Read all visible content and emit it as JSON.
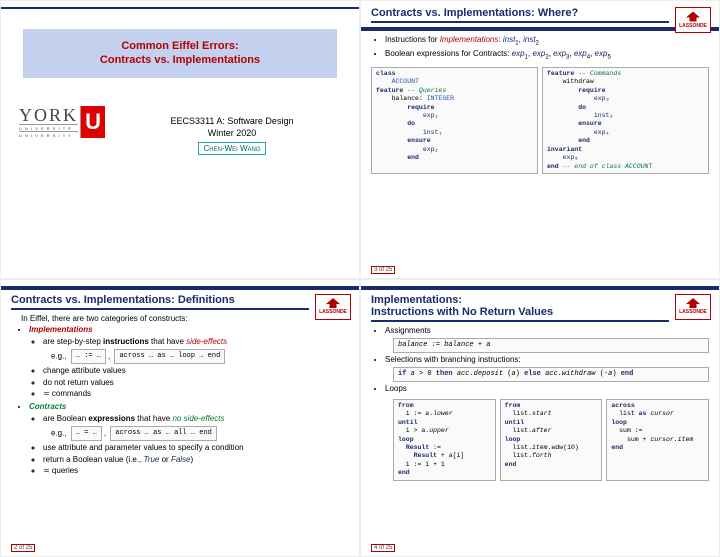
{
  "slides": [
    {
      "banner_line1": "Common Eiffel Errors:",
      "banner_line2": "Contracts vs. Implementations",
      "course": "EECS3311 A: Software Design",
      "term": "Winter 2020",
      "author": "Chen-Wei Wang",
      "york": "YORK",
      "york_sub1": "U N I V E R S I T É",
      "york_sub2": "U N I V E R S I T Y",
      "york_u": "U",
      "lassonde": "LASSONDE"
    },
    {
      "title": "Contracts vs. Implementations: Where?",
      "lassonde": "LASSONDE",
      "bul1a": "Instructions for ",
      "bul1b": "Implementations",
      "bul1c": ": ",
      "inst1": "inst",
      "inst2": "inst",
      "bul2a": "Boolean expressions for Contracts: ",
      "exp": "exp",
      "code_left": "class\n    ACCOUNT\nfeature -- Queries\n    balance: INTEGER\n        require\n            exp₁\n        do\n            inst₁\n        ensure\n            exp₂\n        end",
      "code_right": "feature -- Commands\n    withdraw\n        require\n            exp₃\n        do\n            inst₂\n        ensure\n            exp₄\n        end\ninvariant\n    exp₅\nend -- end of class ACCOUNT",
      "page": "3 of 25"
    },
    {
      "title": "Contracts vs. Implementations: Definitions",
      "lassonde": "LASSONDE",
      "intro": "In Eiffel, there are two categories of constructs:",
      "cat1": "Implementations",
      "c1b1a": "are step-by-step ",
      "c1b1b": "instructions",
      "c1b1c": " that have ",
      "c1b1d": "side-effects",
      "eg": "e.g., ",
      "code1a": "… := …",
      "code1b": "across … as … loop … end",
      "c1b2": "change attribute values",
      "c1b3": "do not return values",
      "c1b4": "≍ commands",
      "cat2": "Contracts",
      "c2b1a": "are Boolean ",
      "c2b1b": "expressions",
      "c2b1c": " that have ",
      "c2b1d": "no side-effects",
      "code2a": "… = …",
      "code2b": "across … as … all … end",
      "c2b2": "use attribute and parameter values to specify a condition",
      "c2b3a": "return a Boolean value (i.e., ",
      "c2b3b": "True",
      "c2b3c": " or ",
      "c2b3d": "False",
      "c2b3e": ")",
      "c2b4": "≍ queries",
      "page": "2 of 25"
    },
    {
      "title1": "Implementations:",
      "title2": "Instructions with No Return Values",
      "lassonde": "LASSONDE",
      "b1": "Assignments",
      "code1": "balance := balance + a",
      "b2": "Selections with branching instructions:",
      "code2": "if a > 0 then acc.deposit (a) else acc.withdraw (-a) end",
      "b3": "Loops",
      "loop1": "from\n  i := a.lower\nuntil\n  i > a.upper\nloop\n  Result :=\n    Result + a[i]\n  i := i + 1\nend",
      "loop2": "from\n  list.start\nuntil\n  list.after\nloop\n  list.item.wdw(10)\n  list.forth\nend",
      "loop3": "across\n  list as cursor\nloop\n  sum :=\n    sum + cursor.item\nend",
      "page": "4 of 25"
    }
  ]
}
